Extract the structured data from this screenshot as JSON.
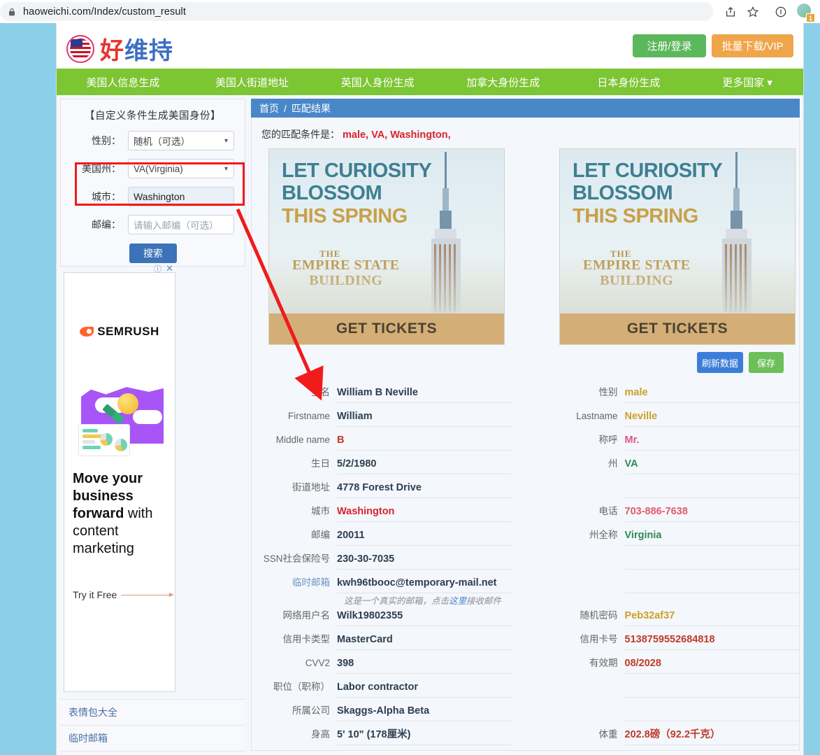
{
  "browser": {
    "url": "haoweichi.com/Index/custom_result",
    "lock_icon": "lock-icon",
    "share_icon": "share-icon",
    "bookmark_icon": "star-icon",
    "info_icon": "info-circle-icon",
    "profile_badge": "1"
  },
  "header": {
    "logo_part1": "好",
    "logo_part2": "维持",
    "register_label": "注册/登录",
    "vip_label": "批量下载/VIP",
    "colors": {
      "green": "#5cb85c",
      "orange": "#efa54a",
      "nav_green": "#7cc533",
      "crumb_blue": "#4a87c9"
    }
  },
  "nav": {
    "items": [
      "美国人信息生成",
      "美国人街道地址",
      "英国人身份生成",
      "加拿大身份生成",
      "日本身份生成",
      "更多国家 ▾"
    ]
  },
  "filter": {
    "title": "【自定义条件生成美国身份】",
    "rows": [
      {
        "label": "性别：",
        "value": "随机（可选）",
        "type": "select"
      },
      {
        "label": "美国州：",
        "value": "VA(Virginia)",
        "type": "select"
      },
      {
        "label": "城市：",
        "value": "Washington",
        "type": "text"
      },
      {
        "label": "邮编：",
        "value": "",
        "placeholder": "请输入邮编（可选）",
        "type": "text"
      }
    ],
    "search_label": "搜索"
  },
  "ad": {
    "brand": "SEMRUSH",
    "headline_bold": "Move your business forward",
    "headline_thin": "with content marketing",
    "cta": "Try it Free",
    "info_icon": "info-icon",
    "close_icon": "close-icon"
  },
  "side_links": [
    {
      "label": "表情包大全"
    },
    {
      "label": "临时邮箱"
    }
  ],
  "breadcrumb": {
    "home": "首页",
    "sep": "/",
    "current": "匹配结果"
  },
  "condition": {
    "prefix": "您的匹配条件是：",
    "value": "male, VA, Washington,"
  },
  "banner": {
    "line1": "LET CURIOSITY",
    "line2": "BLOSSOM",
    "line3": "THIS SPRING",
    "the": "THE",
    "title1": "EMPIRE STATE",
    "title2": "BUILDING",
    "cta": "GET TICKETS"
  },
  "actions": {
    "refresh_label": "刷新数据",
    "save_label": "保存"
  },
  "details": {
    "rows": [
      {
        "left": {
          "label": "全名",
          "value": "William B Neville",
          "color": "navy"
        },
        "right": {
          "label": "性别",
          "value": "male",
          "color": "gold"
        }
      },
      {
        "left": {
          "label": "Firstname",
          "value": "William",
          "color": "navy"
        },
        "right": {
          "label": "Lastname",
          "value": "Neville",
          "color": "gold"
        }
      },
      {
        "left": {
          "label": "Middle name",
          "value": "B",
          "color": "crimson"
        },
        "right": {
          "label": "称呼",
          "value": "Mr.",
          "color": "pink"
        }
      },
      {
        "left": {
          "label": "生日",
          "value": "5/2/1980",
          "color": "navy"
        },
        "right": {
          "label": "州",
          "value": "VA",
          "color": "green"
        }
      },
      {
        "left": {
          "label": "街道地址",
          "value": "4778 Forest Drive",
          "color": "navy"
        },
        "right": {
          "label": "",
          "value": "",
          "color": "navy"
        }
      },
      {
        "left": {
          "label": "城市",
          "value": "Washington",
          "color": "red"
        },
        "right": {
          "label": "电话",
          "value": "703-886-7638",
          "color": "rose"
        }
      },
      {
        "left": {
          "label": "邮编",
          "value": "20011",
          "color": "navy"
        },
        "right": {
          "label": "州全称",
          "value": "Virginia",
          "color": "green"
        }
      },
      {
        "left": {
          "label": "SSN社会保险号",
          "value": "230-30-7035",
          "color": "navy"
        },
        "right": {
          "label": "",
          "value": "",
          "color": "navy"
        }
      },
      {
        "left": {
          "label": "临时邮箱",
          "value": "kwh96tbooc@temporary-mail.net",
          "color": "navy",
          "label_link": true
        },
        "right": {
          "label": "",
          "value": "",
          "color": "navy"
        }
      },
      {
        "left": {
          "label": "网络用户名",
          "value": "Wilk19802355",
          "color": "navy"
        },
        "right": {
          "label": "随机密码",
          "value": "Peb32af37",
          "color": "gold"
        }
      },
      {
        "left": {
          "label": "信用卡类型",
          "value": "MasterCard",
          "color": "navy"
        },
        "right": {
          "label": "信用卡号",
          "value": "5138759552684818",
          "color": "crimson"
        }
      },
      {
        "left": {
          "label": "CVV2",
          "value": "398",
          "color": "navy"
        },
        "right": {
          "label": "有效期",
          "value": "08/2028",
          "color": "crimson"
        }
      },
      {
        "left": {
          "label": "职位（职称）",
          "value": "Labor contractor",
          "color": "navy"
        },
        "right": {
          "label": "",
          "value": "",
          "color": "navy"
        }
      },
      {
        "left": {
          "label": "所属公司",
          "value": "Skaggs-Alpha Beta",
          "color": "navy"
        },
        "right": {
          "label": "",
          "value": "",
          "color": "navy"
        }
      },
      {
        "left": {
          "label": "身高",
          "value": "5' 10\"  (178厘米)",
          "color": "navy"
        },
        "right": {
          "label": "体重",
          "value": "202.8磅（92.2千克）",
          "color": "crimson"
        }
      }
    ],
    "mail_note_pre": "这是一个真实的邮箱，点击",
    "mail_note_link": "这里",
    "mail_note_post": "接收邮件"
  }
}
